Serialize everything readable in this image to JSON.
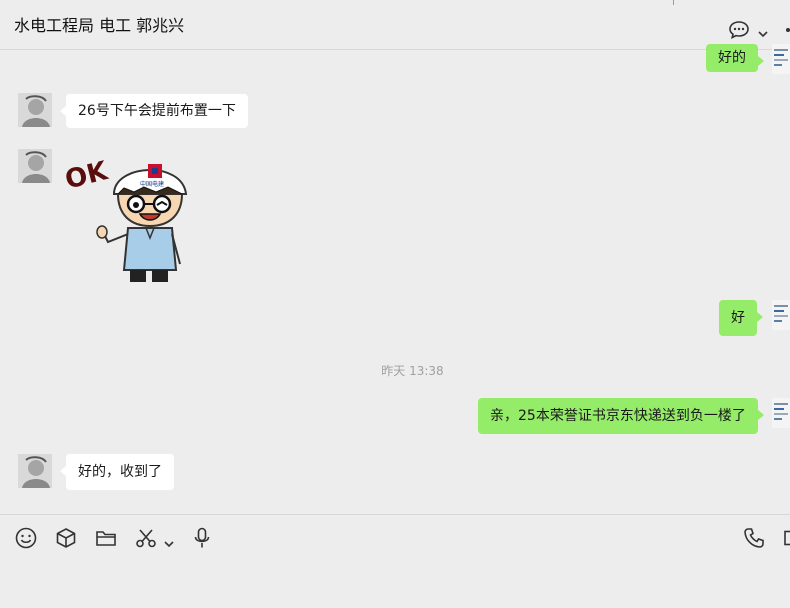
{
  "header": {
    "title": "水电工程局 电工 郭兆兴"
  },
  "messages": {
    "m1": {
      "side": "right",
      "text": "好的"
    },
    "m2": {
      "side": "left",
      "text": "26号下午会提前布置一下"
    },
    "m3": {
      "side": "left",
      "type": "sticker",
      "text": "OK",
      "helmet_text": "中国电建"
    },
    "m4": {
      "side": "right",
      "text": "好"
    },
    "timestamp": "昨天 13:38",
    "m5": {
      "side": "right",
      "text": "亲，25本荣誉证书京东快递送到负一楼了"
    },
    "m6": {
      "side": "left",
      "text": "好的，收到了"
    }
  },
  "toolbar": {
    "icons": [
      "emoji-icon",
      "box-icon",
      "folder-icon",
      "scissors-icon",
      "chevron-down-icon",
      "microphone-icon",
      "phone-icon"
    ]
  },
  "colors": {
    "background": "#ededed",
    "bubble_self": "#95ec69",
    "bubble_other": "#ffffff",
    "sticker_text": "#5a0d0d"
  }
}
